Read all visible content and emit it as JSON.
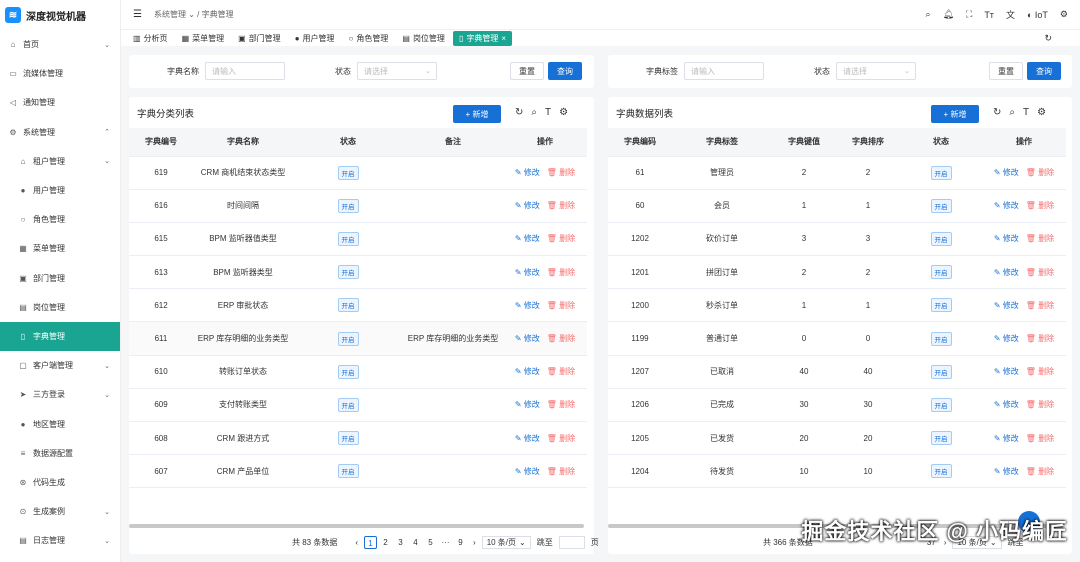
{
  "app": {
    "name": "深度视觉机器"
  },
  "sidebar": {
    "items": [
      {
        "label": "首页",
        "icon": "home-icon",
        "chevron": "⌄"
      },
      {
        "label": "流媒体管理",
        "icon": "screen-icon",
        "chevron": ""
      },
      {
        "label": "通知管理",
        "icon": "megaphone-icon",
        "chevron": ""
      },
      {
        "label": "系统管理",
        "icon": "gear-icon",
        "chevron": "⌃"
      },
      {
        "label": "租户管理",
        "icon": "house-icon",
        "chevron": "⌄"
      },
      {
        "label": "用户管理",
        "icon": "user-icon",
        "chevron": ""
      },
      {
        "label": "角色管理",
        "icon": "role-icon",
        "chevron": ""
      },
      {
        "label": "菜单管理",
        "icon": "grid-icon",
        "chevron": ""
      },
      {
        "label": "部门管理",
        "icon": "id-card-icon",
        "chevron": ""
      },
      {
        "label": "岗位管理",
        "icon": "badge-icon",
        "chevron": ""
      },
      {
        "label": "字典管理",
        "icon": "book-icon",
        "chevron": ""
      },
      {
        "label": "客户端管理",
        "icon": "client-icon",
        "chevron": "⌄"
      },
      {
        "label": "三方登录",
        "icon": "rocket-icon",
        "chevron": "⌄"
      },
      {
        "label": "地区管理",
        "icon": "pin-icon",
        "chevron": ""
      },
      {
        "label": "数据源配置",
        "icon": "database-icon",
        "chevron": ""
      },
      {
        "label": "代码生成",
        "icon": "code-icon",
        "chevron": ""
      },
      {
        "label": "生成案例",
        "icon": "case-icon",
        "chevron": "⌄"
      },
      {
        "label": "日志管理",
        "icon": "log-icon",
        "chevron": "⌄"
      }
    ]
  },
  "header": {
    "breadcrumb": [
      "系统管理",
      "字典管理"
    ],
    "breadcrumb_sep": "/",
    "lang_label": "IoT"
  },
  "tabs": [
    {
      "label": "分析页",
      "icon": "chart-icon",
      "close": ""
    },
    {
      "label": "菜单管理",
      "icon": "grid-icon",
      "close": ""
    },
    {
      "label": "部门管理",
      "icon": "id-card-icon",
      "close": ""
    },
    {
      "label": "用户管理",
      "icon": "user-icon",
      "close": ""
    },
    {
      "label": "角色管理",
      "icon": "role-icon",
      "close": ""
    },
    {
      "label": "岗位管理",
      "icon": "badge-icon",
      "close": ""
    },
    {
      "label": "字典管理",
      "icon": "book-icon",
      "close": "×"
    }
  ],
  "left": {
    "filter": {
      "name_label": "字典名称",
      "name_placeholder": "请输入",
      "status_label": "状态",
      "status_placeholder": "请选择",
      "reset": "重置",
      "search": "查询"
    },
    "title": "字典分类列表",
    "add": "+ 新增",
    "columns": [
      "字典编号",
      "字典名称",
      "状态",
      "备注",
      "操作"
    ],
    "rows": [
      {
        "id": "619",
        "name": "CRM 商机结束状态类型",
        "status": "开启",
        "remark": ""
      },
      {
        "id": "616",
        "name": "时间间隔",
        "status": "开启",
        "remark": ""
      },
      {
        "id": "615",
        "name": "BPM 监听器值类型",
        "status": "开启",
        "remark": ""
      },
      {
        "id": "613",
        "name": "BPM 监听器类型",
        "status": "开启",
        "remark": ""
      },
      {
        "id": "612",
        "name": "ERP 审批状态",
        "status": "开启",
        "remark": ""
      },
      {
        "id": "611",
        "name": "ERP 库存明细的业务类型",
        "status": "开启",
        "remark": "ERP 库存明细的业务类型"
      },
      {
        "id": "610",
        "name": "转账订单状态",
        "status": "开启",
        "remark": ""
      },
      {
        "id": "609",
        "name": "支付转账类型",
        "status": "开启",
        "remark": ""
      },
      {
        "id": "608",
        "name": "CRM 跟进方式",
        "status": "开启",
        "remark": ""
      },
      {
        "id": "607",
        "name": "CRM 产品单位",
        "status": "开启",
        "remark": ""
      }
    ],
    "edit": "修改",
    "delete": "删除",
    "pager": {
      "total": "共 83 条数据",
      "pages": [
        "1",
        "2",
        "3",
        "4",
        "5",
        "···",
        "9"
      ],
      "size": "10 条/页",
      "jump": "跳至",
      "page_unit": "页"
    }
  },
  "right": {
    "filter": {
      "label_label": "字典标签",
      "label_placeholder": "请输入",
      "status_label": "状态",
      "status_placeholder": "请选择",
      "reset": "重置",
      "search": "查询"
    },
    "title": "字典数据列表",
    "add": "+ 新增",
    "columns": [
      "字典编码",
      "字典标签",
      "字典键值",
      "字典排序",
      "状态",
      "操作"
    ],
    "rows": [
      {
        "code": "61",
        "label": "管理员",
        "value": "2",
        "sort": "2",
        "status": "开启"
      },
      {
        "code": "60",
        "label": "会员",
        "value": "1",
        "sort": "1",
        "status": "开启"
      },
      {
        "code": "1202",
        "label": "砍价订单",
        "value": "3",
        "sort": "3",
        "status": "开启"
      },
      {
        "code": "1201",
        "label": "拼团订单",
        "value": "2",
        "sort": "2",
        "status": "开启"
      },
      {
        "code": "1200",
        "label": "秒杀订单",
        "value": "1",
        "sort": "1",
        "status": "开启"
      },
      {
        "code": "1199",
        "label": "普通订单",
        "value": "0",
        "sort": "0",
        "status": "开启"
      },
      {
        "code": "1207",
        "label": "已取消",
        "value": "40",
        "sort": "40",
        "status": "开启"
      },
      {
        "code": "1206",
        "label": "已完成",
        "value": "30",
        "sort": "30",
        "status": "开启"
      },
      {
        "code": "1205",
        "label": "已发货",
        "value": "20",
        "sort": "20",
        "status": "开启"
      },
      {
        "code": "1204",
        "label": "待发货",
        "value": "10",
        "sort": "10",
        "status": "开启"
      }
    ],
    "edit": "修改",
    "delete": "删除",
    "pager": {
      "total": "共 366 条数据",
      "tail": "37",
      "size": "10 条/页",
      "jump": "跳至"
    }
  },
  "watermark": "掘金技术社区 @ 小码编匠",
  "colors": {
    "accent": "#1aa592",
    "primary": "#1670d6",
    "danger": "#f56c6c"
  }
}
